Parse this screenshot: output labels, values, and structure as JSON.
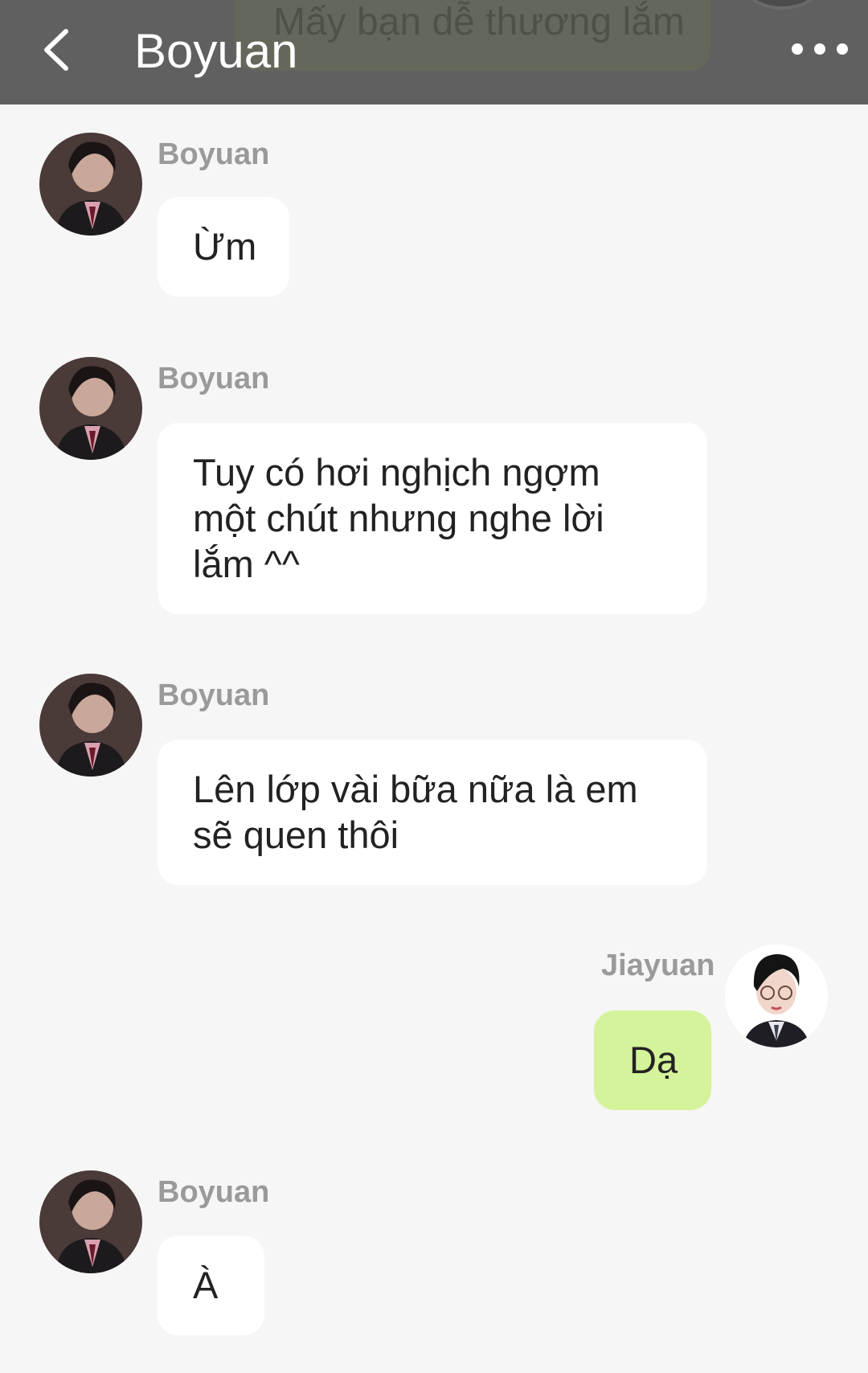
{
  "header": {
    "title": "Boyuan",
    "behind_text": "Mấy bạn dễ thương lắm",
    "back_icon": "chevron-left-icon",
    "more_icon": "more-horizontal-icon"
  },
  "messages": [
    {
      "sender": "Boyuan",
      "text": "Ừm",
      "side": "left"
    },
    {
      "sender": "Boyuan",
      "text": "Tuy có hơi nghịch ngợm\nmột chút nhưng nghe lời\nlắm ^^",
      "side": "left"
    },
    {
      "sender": "Boyuan",
      "text": "Lên lớp vài bữa nữa là em\nsẽ quen thôi",
      "side": "left"
    },
    {
      "sender": "Jiayuan",
      "text": "Dạ",
      "side": "right"
    },
    {
      "sender": "Boyuan",
      "text": "À",
      "side": "left"
    }
  ],
  "colors": {
    "header_bg": "#606060",
    "page_bg": "#f6f6f6",
    "incoming_bubble": "#ffffff",
    "outgoing_bubble": "#d5f39a",
    "sender_name": "#9a9a9a"
  }
}
